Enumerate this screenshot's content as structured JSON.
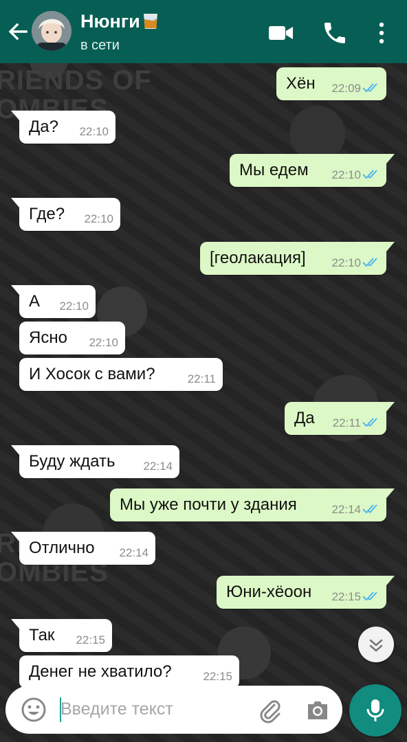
{
  "header": {
    "contact_name": "Нюнги",
    "status": "в сети",
    "name_emoji": "whisky-glass-emoji"
  },
  "messages": [
    {
      "text": "Хён",
      "time": "22:09",
      "direction": "out",
      "status": "read"
    },
    {
      "text": "Да?",
      "time": "22:10",
      "direction": "in"
    },
    {
      "text": "Мы едем",
      "time": "22:10",
      "direction": "out",
      "status": "read"
    },
    {
      "text": "Где?",
      "time": "22:10",
      "direction": "in"
    },
    {
      "text": "[геолакация]",
      "time": "22:10",
      "direction": "out",
      "status": "read"
    },
    {
      "text": "А",
      "time": "22:10",
      "direction": "in"
    },
    {
      "text": "Ясно",
      "time": "22:10",
      "direction": "in"
    },
    {
      "text": "И Хосок с вами?",
      "time": "22:11",
      "direction": "in"
    },
    {
      "text": "Да",
      "time": "22:11",
      "direction": "out",
      "status": "read"
    },
    {
      "text": "Буду ждать",
      "time": "22:14",
      "direction": "in"
    },
    {
      "text": "Мы уже почти у здания",
      "time": "22:14",
      "direction": "out",
      "status": "read"
    },
    {
      "text": "Отлично",
      "time": "22:14",
      "direction": "in"
    },
    {
      "text": "Юни-хёоон",
      "time": "22:15",
      "direction": "out",
      "status": "read"
    },
    {
      "text": "Так",
      "time": "22:15",
      "direction": "in"
    },
    {
      "text": "Денег не хватило?",
      "time": "22:15",
      "direction": "in"
    }
  ],
  "wallpaper_text": {
    "top": "RIENDS OF\nOMBIES",
    "bottom": "RIENDS OF\nOMBIES"
  },
  "composer": {
    "placeholder": "Введите текст",
    "value": ""
  },
  "icons": {
    "back": "arrow-left-icon",
    "video": "video-camera-icon",
    "call": "phone-icon",
    "menu": "more-vertical-icon",
    "emoji": "smiley-icon",
    "attach": "paperclip-icon",
    "camera": "camera-icon",
    "mic": "microphone-icon",
    "scroll": "chevrons-down-icon",
    "read_ticks": "double-check-icon"
  },
  "colors": {
    "header": "#075e54",
    "outgoing_bubble": "#dcf8c6",
    "incoming_bubble": "#ffffff",
    "read_ticks": "#4fb6ec",
    "mic_button": "#128c7e"
  }
}
